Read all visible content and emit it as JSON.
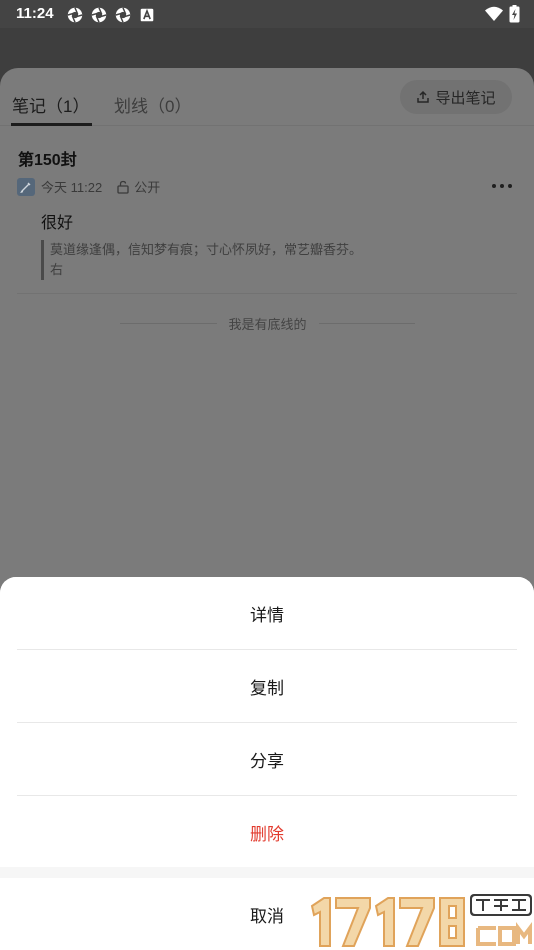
{
  "status_bar": {
    "time": "11:24",
    "left_icons": [
      "aperture-icon",
      "aperture-icon",
      "aperture-icon",
      "a-box-icon"
    ],
    "right_icons": [
      "wifi-icon",
      "battery-charging-icon"
    ]
  },
  "tabs": {
    "notes_label": "笔记（1）",
    "highlights_label": "划线（0）",
    "export_label": "导出笔记"
  },
  "note": {
    "title": "第150封",
    "date": "今天 11:22",
    "visibility": "公开",
    "body": "很好",
    "quote_line1": "莫道缘逢偶，信知梦有痕；寸心怀夙好，常艺瓣香芬。",
    "quote_line2": "右"
  },
  "list_end": "我是有底线的",
  "sheet": {
    "details": "详情",
    "copy": "复制",
    "share": "分享",
    "delete": "删除",
    "cancel": "取消"
  },
  "colors": {
    "danger": "#e23b2e",
    "overlay": "#7b7b7b"
  }
}
